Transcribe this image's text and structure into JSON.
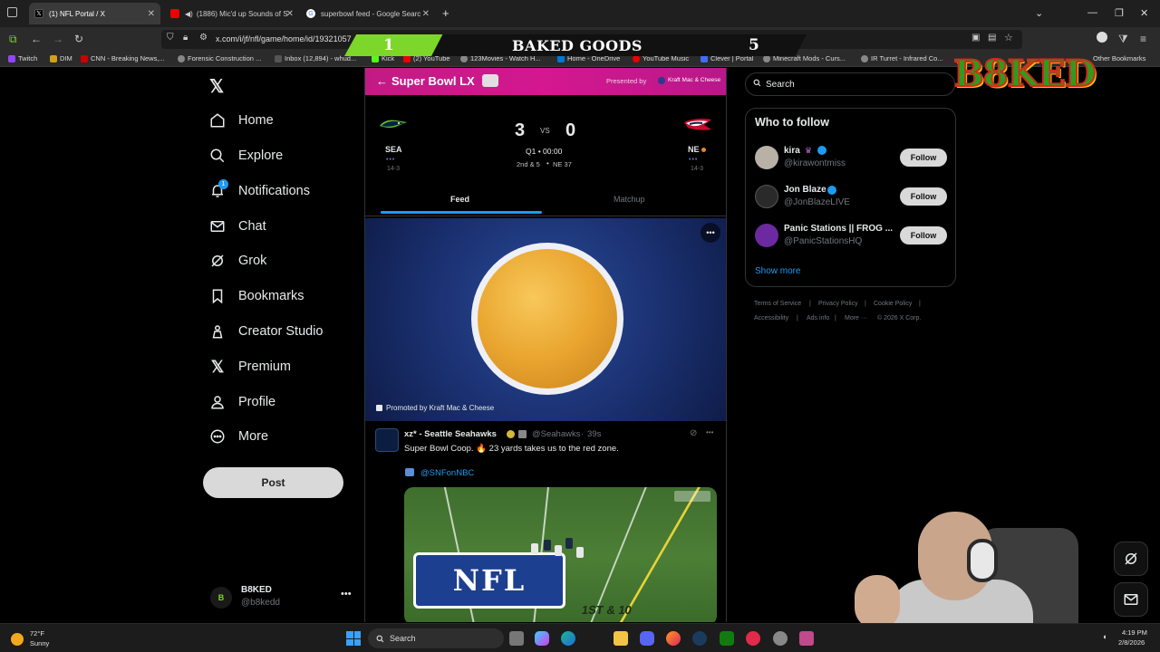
{
  "browser": {
    "tabs": [
      {
        "title": "(1) NFL Portal / X",
        "active": true
      },
      {
        "title": "(1886) Mic'd up Sounds of S",
        "active": false
      },
      {
        "title": "superbowl feed - Google Searc",
        "active": false
      }
    ],
    "new_tab": "+",
    "url": "x.com/i/jf/nfl/game/home/id/19321057",
    "bookmarks": [
      "Twitch",
      "DIM",
      "CNN - Breaking News,...",
      "Forensic Construction ...",
      "Inbox (12,894) - whud...",
      "Kick",
      "(2) YouTube",
      "123Movies - Watch H...",
      "Home - OneDrive",
      "YouTube Music",
      "Clever | Portal",
      "Minecraft Mods - Curs...",
      "IR Turret - Infrared Co...",
      "Other Bookmarks"
    ]
  },
  "overlay": {
    "left_score": "1",
    "title": "BAKED GOODS",
    "right_score": "5",
    "logo": "B8KED"
  },
  "sidebar": {
    "items": [
      {
        "label": "Home"
      },
      {
        "label": "Explore"
      },
      {
        "label": "Notifications"
      },
      {
        "label": "Chat"
      },
      {
        "label": "Grok"
      },
      {
        "label": "Bookmarks"
      },
      {
        "label": "Creator Studio"
      },
      {
        "label": "Premium"
      },
      {
        "label": "Profile"
      },
      {
        "label": "More"
      }
    ],
    "notif_count": "1",
    "post_label": "Post",
    "account": {
      "name": "B8KED",
      "handle": "@b8kedd"
    }
  },
  "game": {
    "header_title": "Super Bowl LX",
    "presented_by": "Presented by",
    "sponsor": "Kraft Mac & Cheese",
    "home": {
      "abbr": "SEA",
      "record": "14-3",
      "score": "3"
    },
    "away": {
      "abbr": "NE",
      "record": "14-3",
      "score": "0"
    },
    "vs": "VS",
    "clock": "Q1 • 00:00",
    "down": "2nd & 5",
    "spot": "NE 37",
    "tabs": [
      "Feed",
      "Matchup"
    ]
  },
  "promo": {
    "label": "Promoted by Kraft Mac & Cheese"
  },
  "post": {
    "author": "xz* - Seattle Seahawks",
    "handle": "@Seahawks",
    "time": "39s",
    "text": "Super Bowl Coop. 🔥 23 yards takes us to the red zone.",
    "mention": "@SNFonNBC",
    "field_text": "NFL",
    "field_down": "1ST & 10"
  },
  "right": {
    "search_placeholder": "Search",
    "wtf_title": "Who to follow",
    "follow_label": "Follow",
    "accounts": [
      {
        "name": "kira",
        "handle": "@kirawontmiss"
      },
      {
        "name": "Jon Blaze",
        "handle": "@JonBlazeLIVE"
      },
      {
        "name": "Panic Stations || FROG ...",
        "handle": "@PanicStationsHQ"
      }
    ],
    "show_more": "Show more",
    "footer": [
      "Terms of Service",
      "Privacy Policy",
      "Cookie Policy",
      "Accessibility",
      "Ads info",
      "More ···",
      "© 2026 X Corp."
    ]
  },
  "taskbar": {
    "weather_temp": "72°F",
    "weather_desc": "Sunny",
    "search": "Search",
    "time": "4:19 PM",
    "date": "2/8/2026"
  }
}
